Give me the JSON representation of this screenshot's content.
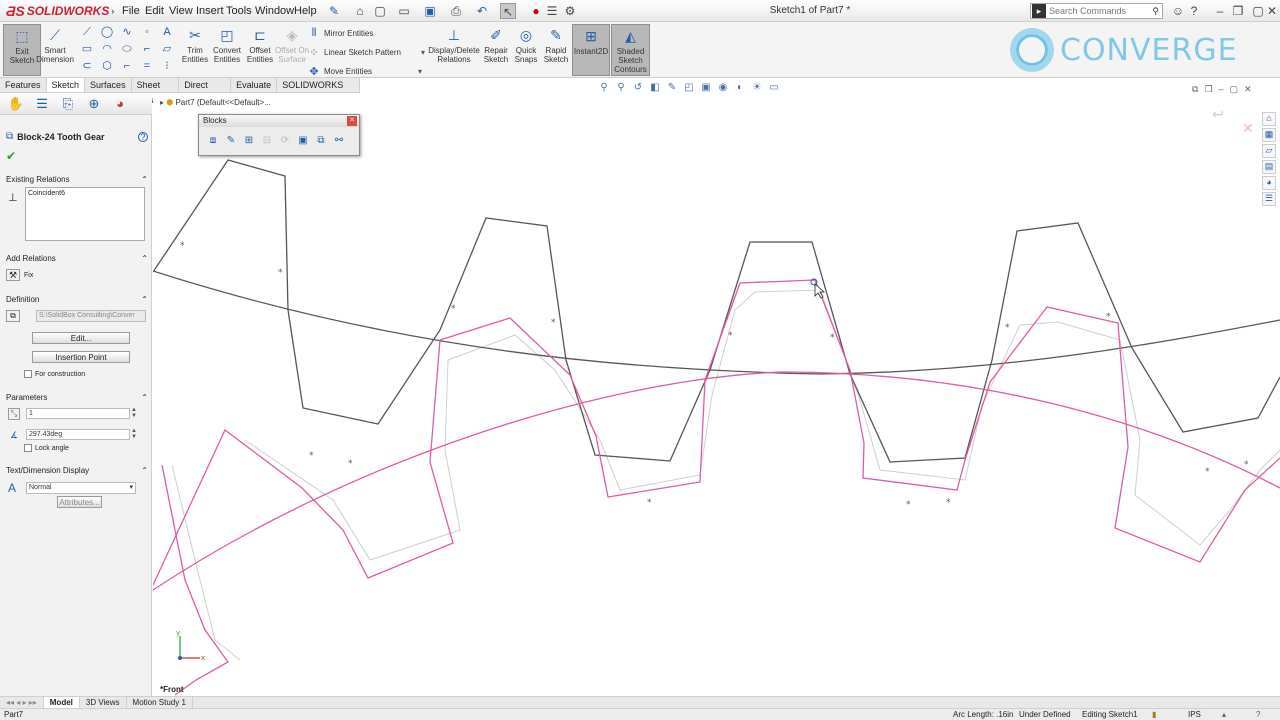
{
  "app": {
    "brand": "SOLIDWORKS",
    "window_title": "Sketch1 of Part7 *",
    "menu": [
      "File",
      "Edit",
      "View",
      "Insert",
      "Tools",
      "Window",
      "Help"
    ],
    "search_placeholder": "Search Commands"
  },
  "command_manager": {
    "exit_sketch": "Exit Sketch",
    "smart_dimension": "Smart Dimension",
    "trim_entities": "Trim Entities",
    "convert_entities": "Convert Entities",
    "offset_entities": "Offset Entities",
    "offset_on_surface": "Offset On Surface",
    "mirror_entities": "Mirror Entities",
    "linear_sketch_pattern": "Linear Sketch Pattern",
    "move_entities": "Move Entities",
    "display_delete_relations": "Display/Delete Relations",
    "repair_sketch": "Repair Sketch",
    "quick_snaps": "Quick Snaps",
    "rapid_sketch": "Rapid Sketch",
    "instant2d": "Instant2D",
    "shaded_sketch_contours": "Shaded Sketch Contours"
  },
  "watermark": "CONVERGE",
  "tabs": [
    "Features",
    "Sketch",
    "Surfaces",
    "Sheet Metal",
    "Direct Editing",
    "Evaluate",
    "SOLIDWORKS Add-Ins"
  ],
  "active_tab": "Sketch",
  "breadcrumb": "Part7  (Default<<Default>...",
  "property_manager": {
    "title": "Block-24 Tooth Gear",
    "existing_relations": {
      "header": "Existing Relations",
      "items": [
        "Coincident6"
      ]
    },
    "add_relations": {
      "header": "Add Relations",
      "items": [
        "Fix"
      ]
    },
    "definition": {
      "header": "Definition",
      "path": "S:\\SolidBox Consulting\\Conver",
      "edit_button": "Edit...",
      "insertion_point_button": "Insertion Point",
      "for_construction": "For construction"
    },
    "parameters": {
      "header": "Parameters",
      "scale": "1",
      "angle": "297.43deg",
      "lock_angle": "Lock angle"
    },
    "text_display": {
      "header": "Text/Dimension Display",
      "font_option": "Normal",
      "attributes_button": "Attributes..."
    }
  },
  "blocks_toolbar": {
    "title": "Blocks"
  },
  "view_label": "*Front",
  "bottom_tabs": [
    "Model",
    "3D Views",
    "Motion Study 1"
  ],
  "active_bottom_tab": "Model",
  "status": {
    "left": "Part7",
    "arc_length": "Arc Length: .16in",
    "definition_state": "Under Defined",
    "mode": "Editing Sketch1",
    "units": "IPS"
  },
  "colors": {
    "sketch_gray": "#555555",
    "sketch_pink": "#e05aa8",
    "construction": "#c8c8c8",
    "accent_blue": "#1f5fa8"
  }
}
